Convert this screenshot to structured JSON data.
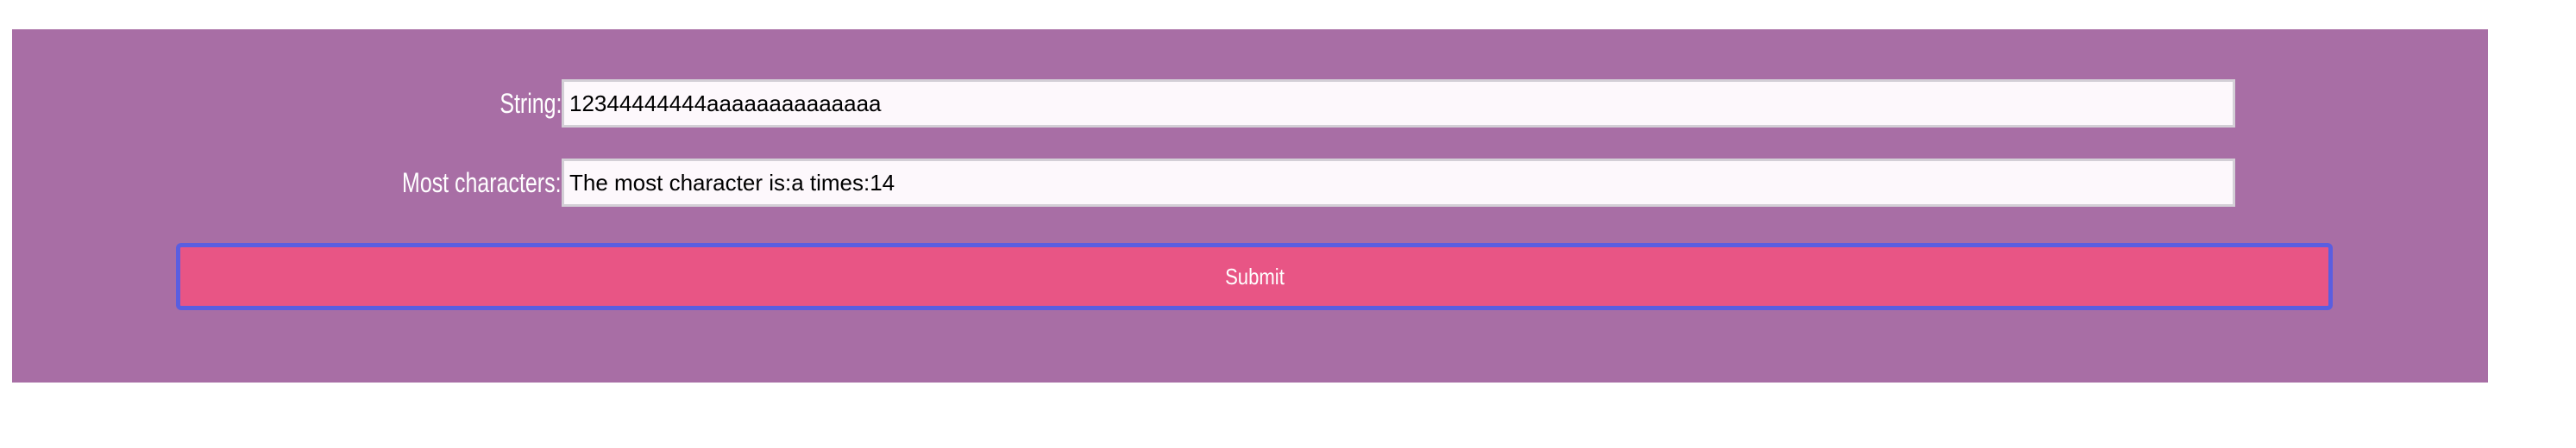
{
  "form": {
    "string_label": "String:",
    "string_value": "12344444444aaaaaaaaaaaaaa",
    "most_label": "Most characters:",
    "most_value": "The most character is:a times:14",
    "submit_label": "Submit"
  },
  "colors": {
    "panel_background": "#a86ea5",
    "submit_background": "#e85585",
    "submit_border": "#5a5ee0",
    "field_background": "#fdf8fc"
  }
}
